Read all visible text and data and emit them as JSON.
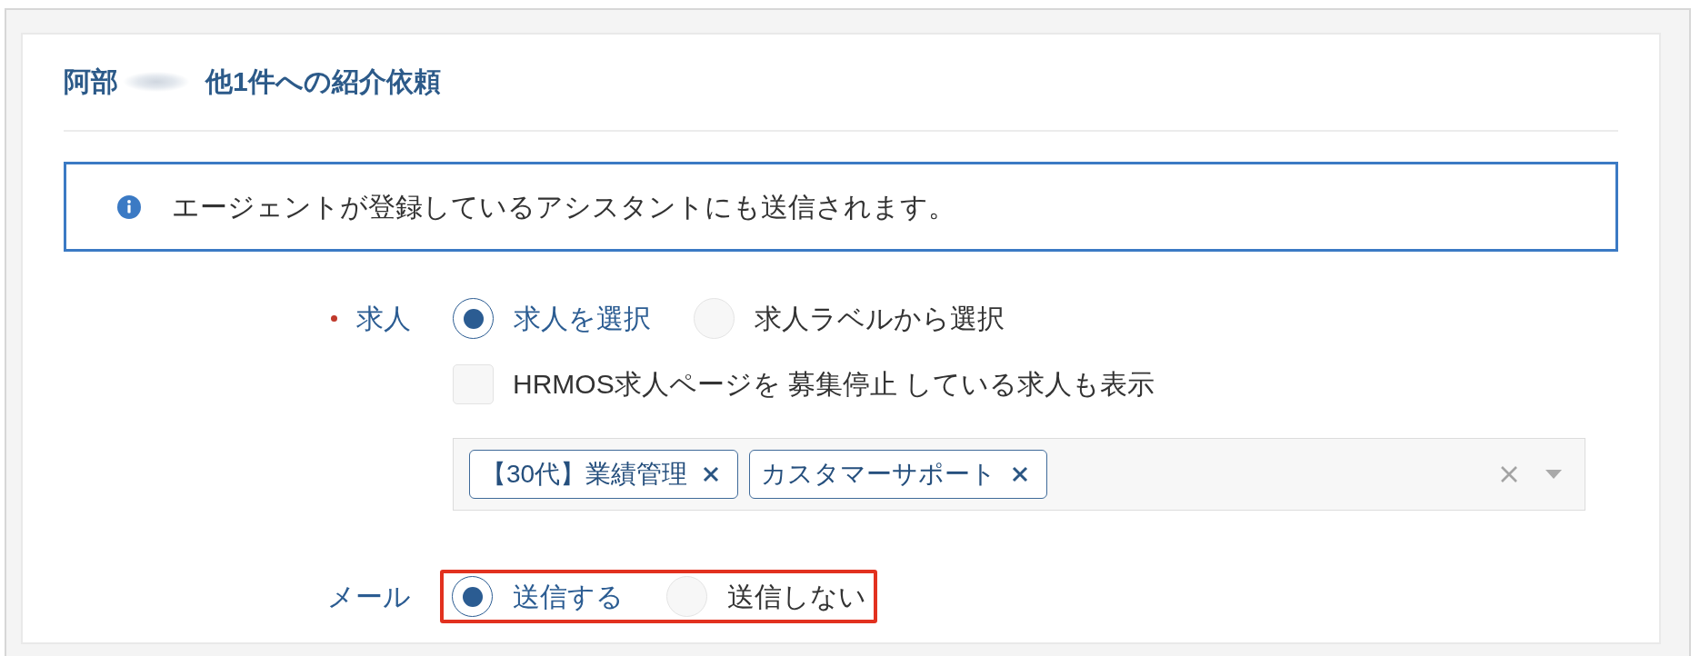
{
  "title": {
    "prefix": "阿部",
    "name_blurred": true,
    "suffix": "他1件への紹介依頼"
  },
  "notice": {
    "kind": "info",
    "text": "エージェントが登録しているアシスタントにも送信されます。"
  },
  "fields": [
    {
      "label": "求人",
      "required": true,
      "highlighted": false,
      "options": [
        {
          "label": "求人を選択",
          "selected": true
        },
        {
          "label": "求人ラベルから選択",
          "selected": false
        }
      ],
      "checkbox": {
        "label": "HRMOS求人ページを 募集停止 している求人も表示",
        "checked": false
      },
      "select": {
        "tags": [
          "【30代】業績管理",
          "カスタマーサポート"
        ]
      }
    },
    {
      "label": "メール",
      "required": false,
      "highlighted": true,
      "options": [
        {
          "label": "送信する",
          "selected": true
        },
        {
          "label": "送信しない",
          "selected": false
        }
      ]
    }
  ]
}
